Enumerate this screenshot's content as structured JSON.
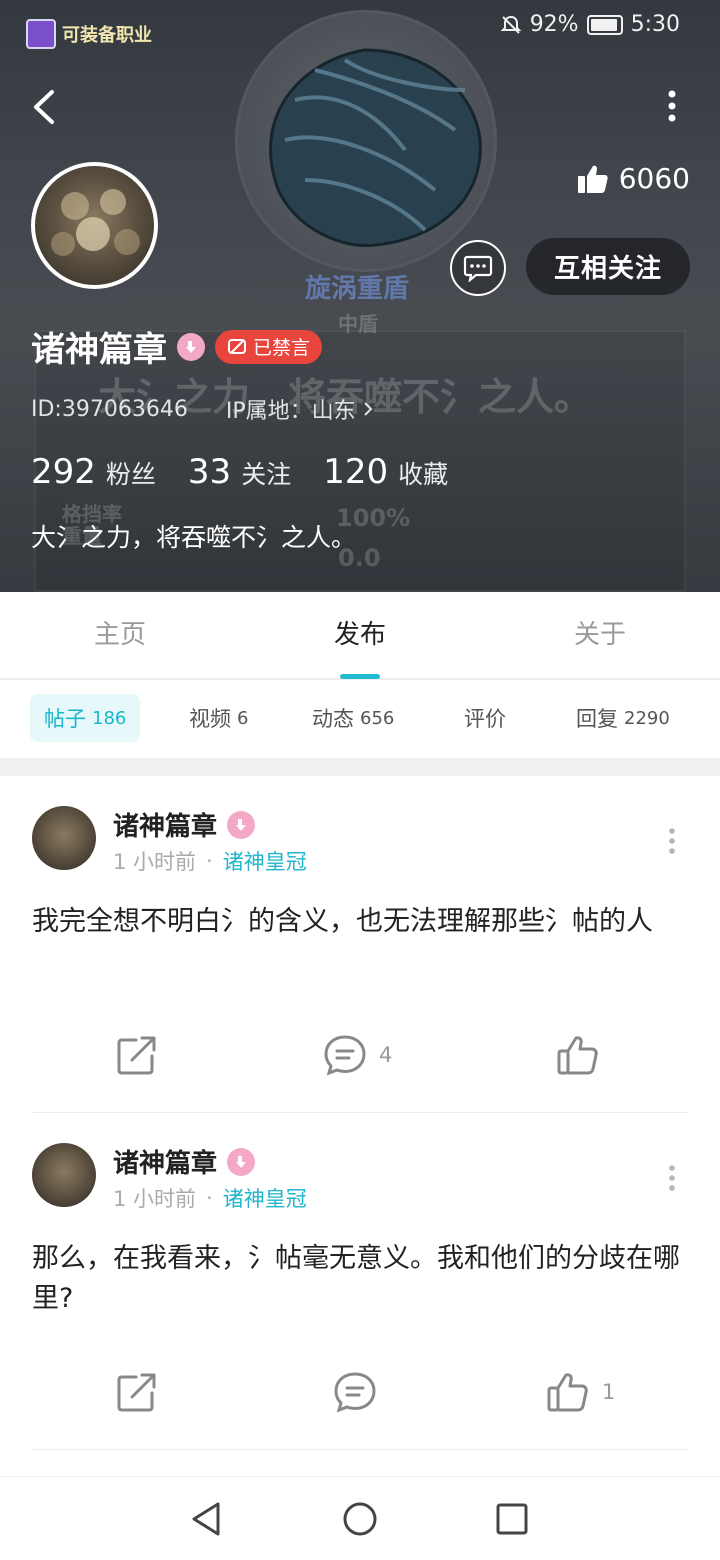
{
  "status_bar": {
    "app_chip_label": "可装备职业",
    "battery_percent": "92%",
    "time": "5:30"
  },
  "background_art": {
    "item_name": "旋涡重盾",
    "item_type": "中盾",
    "flavor_text": "大氵之力，将吞噬不氵之人。",
    "stat_label_1": "格挡率",
    "stat_label_2": "重量",
    "stat_value_1": "100%",
    "stat_value_2": "0.0"
  },
  "profile": {
    "likes": "6060",
    "follow_label": "互相关注",
    "username": "诸神篇章",
    "muted_label": "已禁言",
    "id_text": "ID:397063646",
    "ip_text": "IP属地：山东",
    "stats": [
      {
        "num": "292",
        "label": "粉丝"
      },
      {
        "num": "33",
        "label": "关注"
      },
      {
        "num": "120",
        "label": "收藏"
      }
    ],
    "bio": "大氵之力，将吞噬不氵之人。"
  },
  "main_tabs": [
    "主页",
    "发布",
    "关于"
  ],
  "active_main_tab": "发布",
  "sub_tabs": [
    {
      "label": "帖子",
      "count": "186"
    },
    {
      "label": "视频",
      "count": "6"
    },
    {
      "label": "动态",
      "count": "656"
    },
    {
      "label": "评价",
      "count": ""
    },
    {
      "label": "回复",
      "count": "2290"
    }
  ],
  "posts": [
    {
      "author": "诸神篇章",
      "time": "1 小时前",
      "circle": "诸神皇冠",
      "content": "我完全想不明白氵的含义，也无法理解那些氵帖的人",
      "comments": "4",
      "likes": ""
    },
    {
      "author": "诸神篇章",
      "time": "1 小时前",
      "circle": "诸神皇冠",
      "content": "那么，在我看来，氵帖毫无意义。我和他们的分歧在哪里?",
      "comments": "",
      "likes": "1"
    }
  ],
  "colors": {
    "accent": "#1fbcd2",
    "muted_red": "#e8453c",
    "header_bg": "#4a4f57"
  }
}
